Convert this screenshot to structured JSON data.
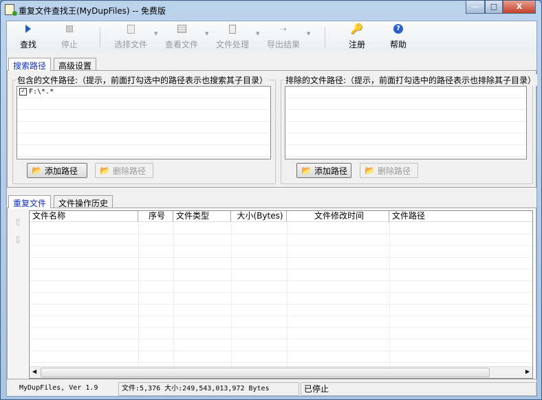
{
  "window": {
    "title": "重复文件查找王(MyDupFiles) -- 免费版",
    "minimize": "—",
    "maximize": "□",
    "close": "X"
  },
  "toolbar": {
    "find": "查找",
    "stop": "停止",
    "select_files": "选择文件",
    "view_files": "查看文件",
    "file_ops": "文件处理",
    "export": "导出结果",
    "register": "注册",
    "help": "帮助"
  },
  "top_tabs": [
    "搜索路径",
    "高级设置"
  ],
  "include": {
    "label": "包含的文件路径:（提示，前面打勾选中的路径表示也搜索其子目录）",
    "items": [
      {
        "path": "F:\\*.*",
        "checked": true
      }
    ],
    "add": "添加路径",
    "remove": "删除路径"
  },
  "exclude": {
    "label": "排除的文件路径:（提示，前面打勾选中的路径表示也排除其子目录）",
    "add": "添加路径",
    "remove": "删除路径"
  },
  "bottom_tabs": [
    "重复文件",
    "文件操作历史"
  ],
  "table": {
    "columns": [
      "文件名称",
      "序号",
      "文件类型",
      "大小(Bytes)",
      "文件修改时间",
      "文件路径"
    ]
  },
  "status": {
    "version": "MyDupFiles, Ver 1.9",
    "summary": "文件:5,376  大小:249,543,013,972 Bytes",
    "state": "已停止"
  }
}
